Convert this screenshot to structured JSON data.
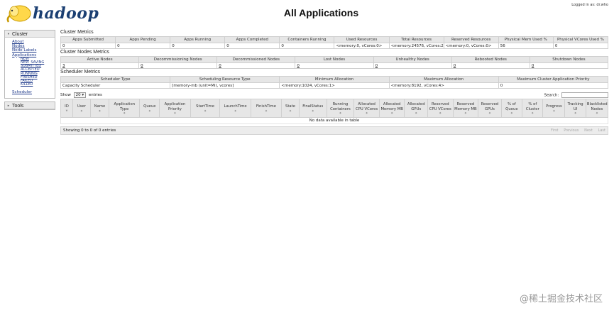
{
  "header": {
    "logo_text": "hadoop",
    "title": "All Applications",
    "login": "Logged in as: dr.who"
  },
  "nav": {
    "cluster_label": "Cluster",
    "cluster_links": [
      "About",
      "Nodes",
      "Node Labels",
      "Applications"
    ],
    "app_states": [
      "NEW",
      "NEW_SAVING",
      "SUBMITTED",
      "ACCEPTED",
      "RUNNING",
      "FINISHED",
      "FAILED",
      "KILLED"
    ],
    "scheduler_link": "Scheduler",
    "tools_label": "Tools"
  },
  "cluster_metrics": {
    "title": "Cluster Metrics",
    "headers": [
      "Apps Submitted",
      "Apps Pending",
      "Apps Running",
      "Apps Completed",
      "Containers Running",
      "Used Resources",
      "Total Resources",
      "Reserved Resources",
      "Physical Mem Used %",
      "Physical VCores Used %"
    ],
    "values": [
      "0",
      "0",
      "0",
      "0",
      "0",
      "<memory:0, vCores:0>",
      "<memory:24576, vCores:24>",
      "<memory:0, vCores:0>",
      "56",
      "0"
    ]
  },
  "cluster_nodes_metrics": {
    "title": "Cluster Nodes Metrics",
    "headers": [
      "Active Nodes",
      "Decommissioning Nodes",
      "Decommissioned Nodes",
      "Lost Nodes",
      "Unhealthy Nodes",
      "Rebooted Nodes",
      "Shutdown Nodes"
    ],
    "values": [
      "3",
      "0",
      "0",
      "0",
      "0",
      "0",
      "0"
    ]
  },
  "scheduler_metrics": {
    "title": "Scheduler Metrics",
    "headers": [
      "Scheduler Type",
      "Scheduling Resource Type",
      "Minimum Allocation",
      "Maximum Allocation",
      "Maximum Cluster Application Priority"
    ],
    "values": [
      "Capacity Scheduler",
      "[memory-mb (unit=Mi), vcores]",
      "<memory:1024, vCores:1>",
      "<memory:8192, vCores:4>",
      "0"
    ]
  },
  "apps_table": {
    "show_label": "Show",
    "page_size": "20",
    "entries_label": "entries",
    "search_label": "Search:",
    "columns": [
      "ID",
      "User",
      "Name",
      "Application Type",
      "Queue",
      "Application Priority",
      "StartTime",
      "LaunchTime",
      "FinishTime",
      "State",
      "FinalStatus",
      "Running Containers",
      "Allocated CPU VCores",
      "Allocated Memory MB",
      "Allocated GPUs",
      "Reserved CPU VCores",
      "Reserved Memory MB",
      "Reserved GPUs",
      "% of Queue",
      "% of Cluster",
      "Progress",
      "Tracking UI",
      "Blacklisted Nodes"
    ],
    "empty_message": "No data available in table",
    "info": "Showing 0 to 0 of 0 entries",
    "pager": [
      "First",
      "Previous",
      "Next",
      "Last"
    ]
  },
  "watermark": "@稀土掘金技术社区"
}
